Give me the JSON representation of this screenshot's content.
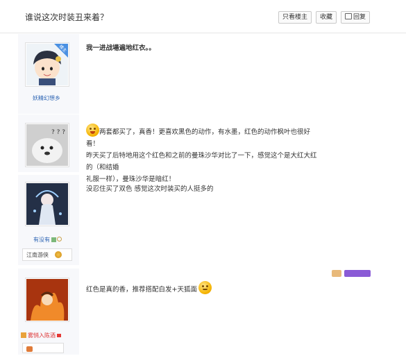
{
  "header": {
    "title": "谁说这次时装丑来着？",
    "only_op_label": "只看楼主",
    "favorite_label": "收藏",
    "reply_label": "回复"
  },
  "posts": [
    {
      "username": "妖精幻想乡",
      "op_badge": "楼主",
      "content_lines": [
        "我一进战場遍地红衣。。"
      ]
    },
    {
      "username": "",
      "content_lines": [
        "两套都买了，真香！更喜欢黑色的动作，有水墨，红色的动作枫叶也很好看！",
        "昨天买了后特地用这个红色和之前的曼珠沙华对比了一下，感觉这个是大红大红的（和结婚",
        "礼服一样），曼珠沙华是暗红！"
      ]
    },
    {
      "username": "有没有",
      "sect": "江南游侠",
      "content_lines": [
        "没忍住买了双色 感觉这次时装买的人挺多的"
      ]
    },
    {
      "username": "雾悄入陈酒",
      "content_lines": [
        "红色是真的香，推荐搭配白发+天狐面"
      ]
    }
  ],
  "colors": {
    "accent_blue": "#4a90e2",
    "link_blue": "#2d64b3",
    "sidebar_bg": "#f7f8fb"
  }
}
